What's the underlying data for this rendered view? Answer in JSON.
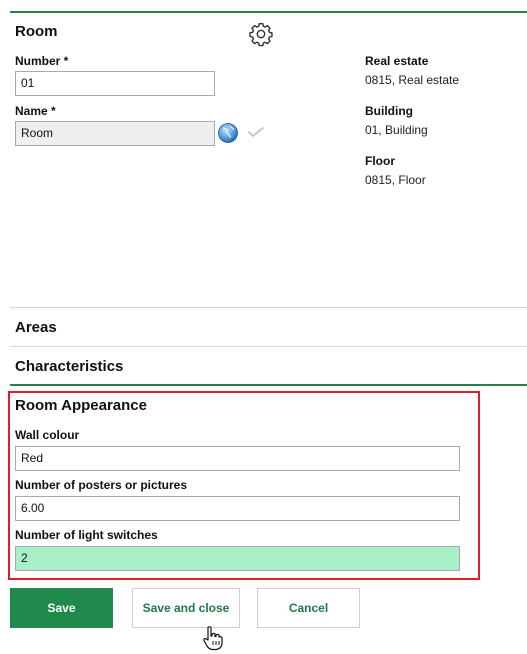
{
  "room_section": {
    "title": "Room",
    "settings_icon": "gear-icon",
    "number_label": "Number *",
    "number_value": "01",
    "name_label": "Name *",
    "name_value": "Room",
    "translate_icon": "globe-icon",
    "spellcheck_icon": "check-icon"
  },
  "info": {
    "real_estate_label": "Real estate",
    "real_estate_value": "0815, Real estate",
    "building_label": "Building",
    "building_value": "01, Building",
    "floor_label": "Floor",
    "floor_value": "0815, Floor"
  },
  "sections": {
    "areas": "Areas",
    "characteristics": "Characteristics"
  },
  "appearance": {
    "title": "Room Appearance",
    "wall_colour_label": "Wall colour",
    "wall_colour_value": "Red",
    "posters_label": "Number of posters or pictures",
    "posters_value": "6.00",
    "switches_label": "Number of light switches",
    "switches_value": "2"
  },
  "buttons": {
    "save": "Save",
    "save_and_close": "Save and close",
    "cancel": "Cancel"
  },
  "colors": {
    "accent": "#1f8a4c",
    "highlight_box": "#d8212b",
    "active_field": "#a8f0c8"
  }
}
